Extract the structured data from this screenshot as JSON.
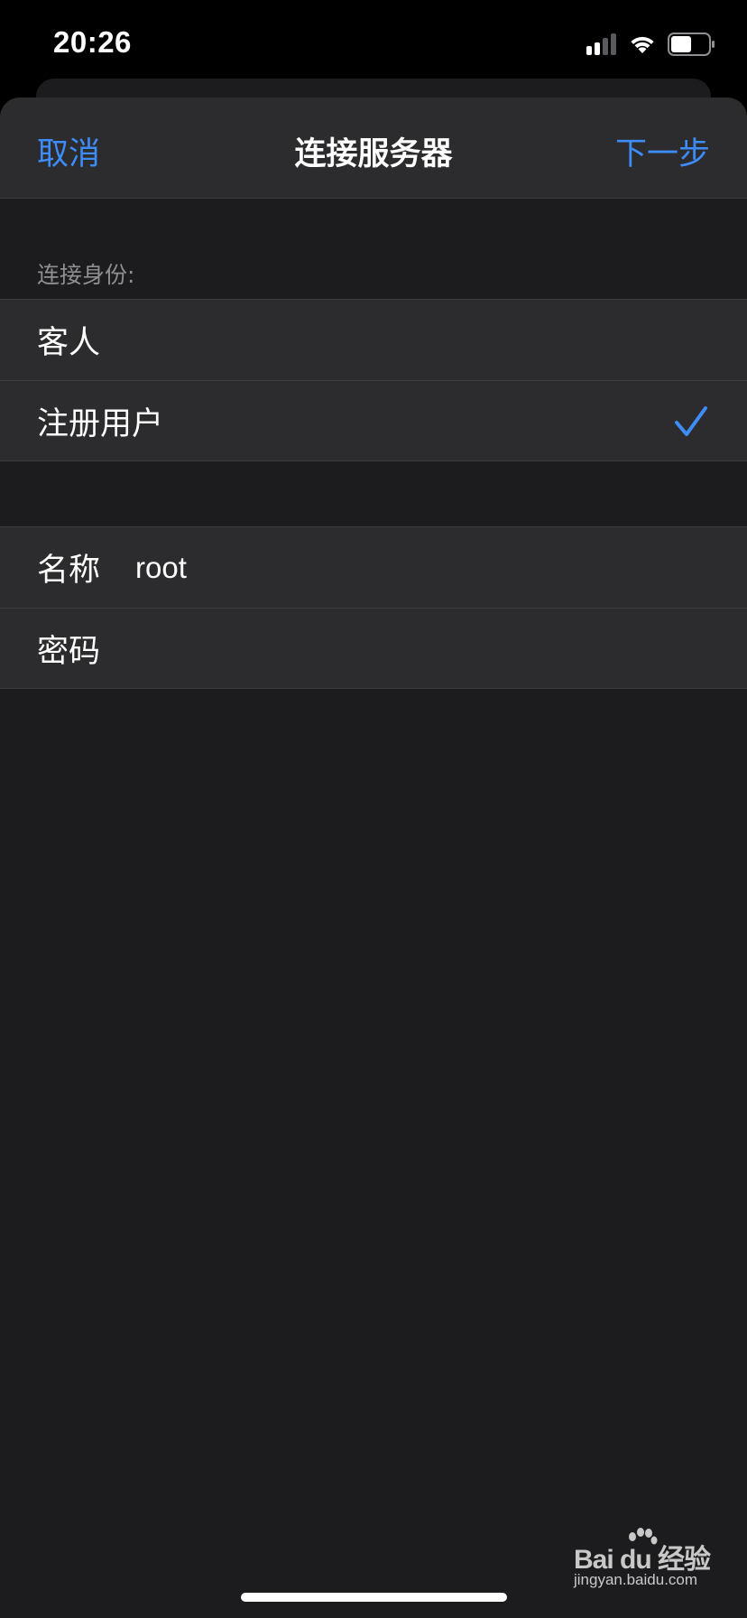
{
  "status_bar": {
    "time": "20:26",
    "icons": [
      "cellular-signal-icon",
      "wifi-icon",
      "battery-icon"
    ]
  },
  "nav": {
    "cancel_label": "取消",
    "title": "连接服务器",
    "next_label": "下一步"
  },
  "identity_section": {
    "header": "连接身份:",
    "options": [
      {
        "label": "客人",
        "selected": false
      },
      {
        "label": "注册用户",
        "selected": true
      }
    ]
  },
  "credentials": {
    "name_label": "名称",
    "name_value": "root",
    "password_label": "密码",
    "password_value": ""
  },
  "watermark": {
    "brand": "Bai du 经验",
    "url": "jingyan.baidu.com"
  },
  "colors": {
    "accent": "#3d8cf7",
    "background": "#1c1c1e",
    "cell": "#2c2c2e",
    "separator": "#3d3d40",
    "secondary_text": "#8e8e93"
  }
}
